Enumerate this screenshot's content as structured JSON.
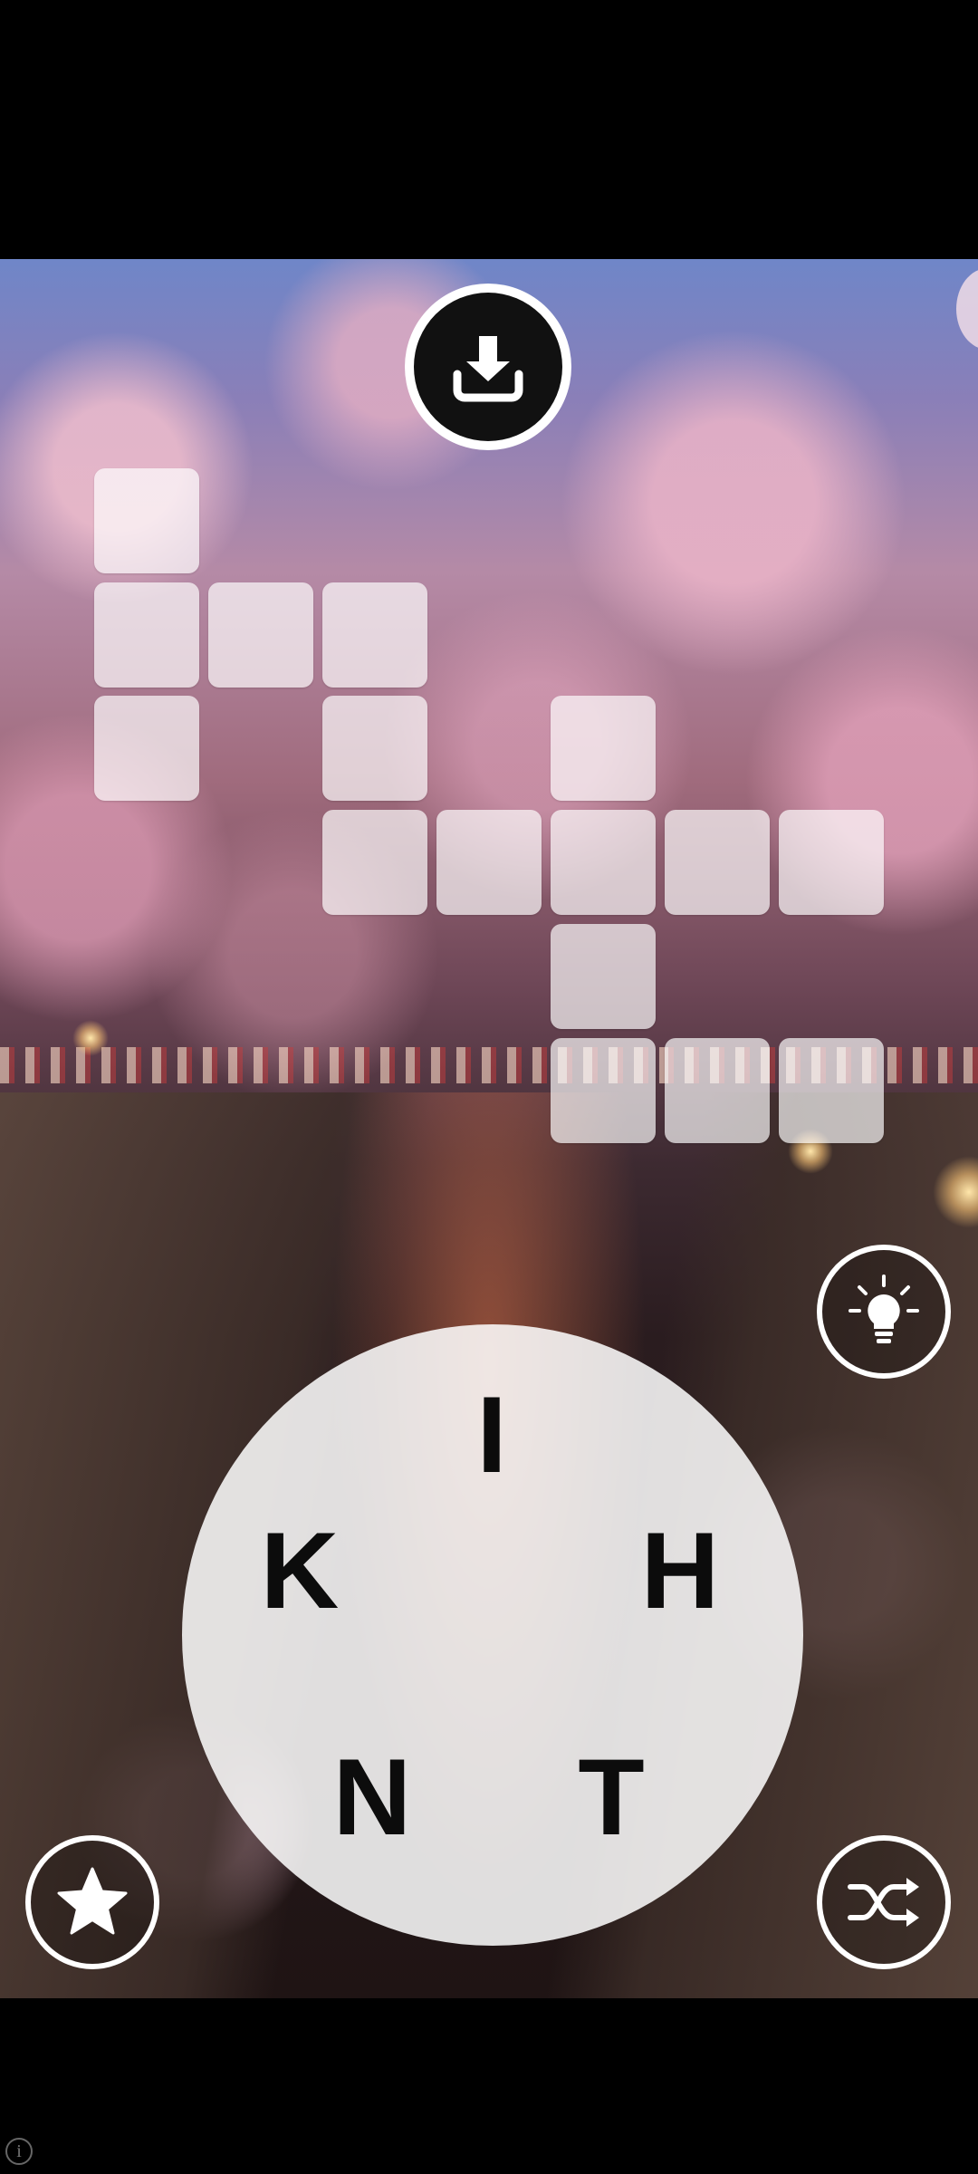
{
  "game": {
    "wheel_letters": [
      "I",
      "H",
      "T",
      "N",
      "K"
    ],
    "buttons": {
      "download": "download-icon",
      "hint": "lightbulb-icon",
      "favorite": "star-icon",
      "shuffle": "shuffle-icon"
    },
    "tile_color": "#ffffff",
    "wheel_color": "#ffffff"
  },
  "footer": {
    "info_glyph": "i"
  }
}
